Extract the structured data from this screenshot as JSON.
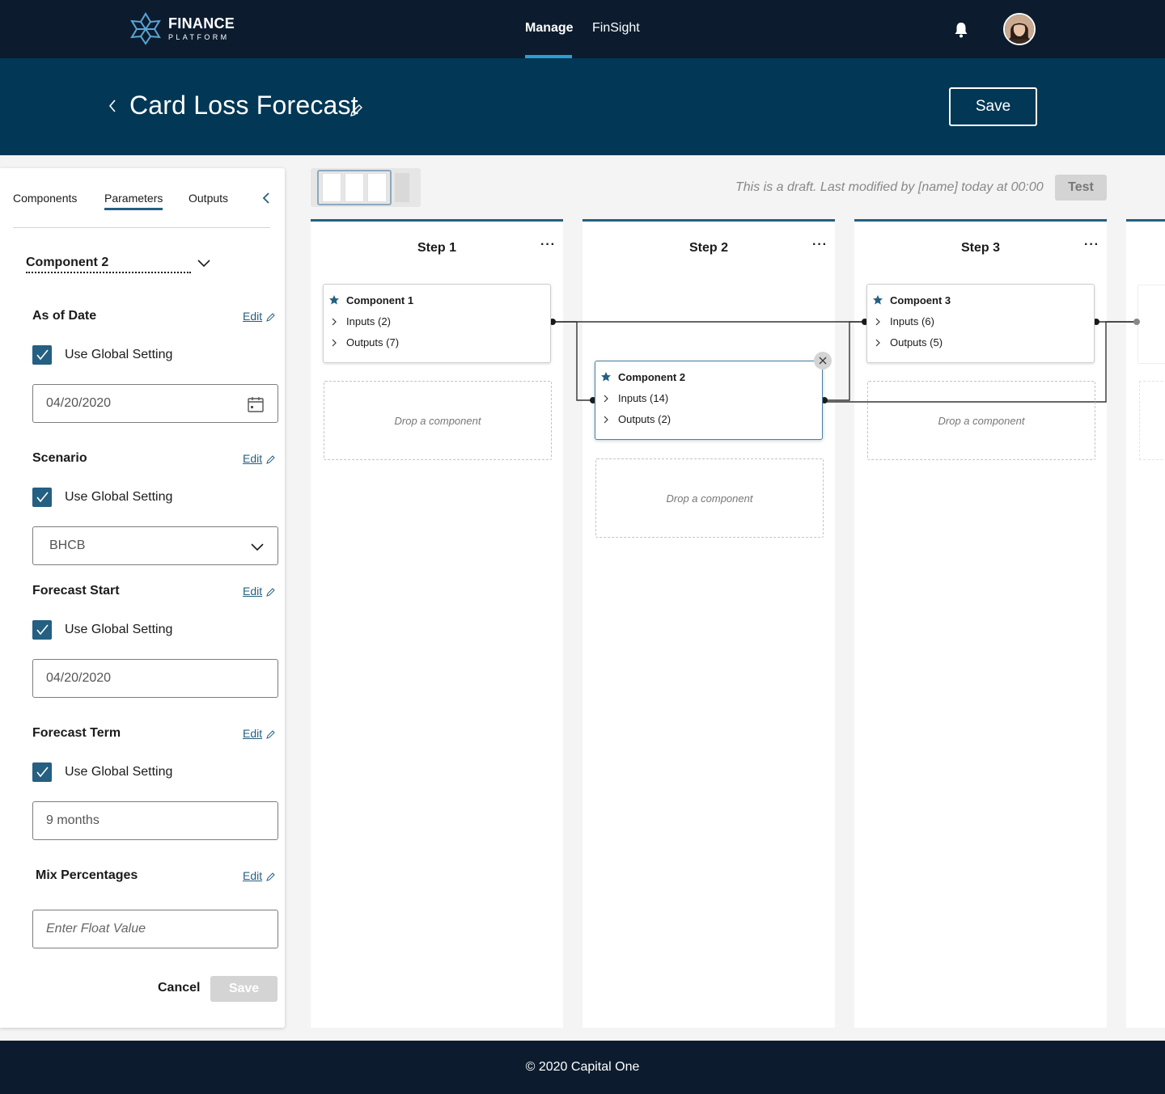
{
  "nav": {
    "logo_line1": "FINANCE",
    "logo_line2": "PLATFORM",
    "items": [
      "Manage",
      "FinSight"
    ],
    "active": "Manage"
  },
  "header": {
    "title": "Card Loss Forecast",
    "save_label": "Save"
  },
  "panel": {
    "tabs": [
      "Components",
      "Parameters",
      "Outputs"
    ],
    "active_tab": "Parameters",
    "component_select": "Component 2",
    "edit_label": "Edit",
    "checkbox_label": "Use Global Setting",
    "params": [
      {
        "label": "As of Date",
        "checked": true,
        "value": "04/20/2020"
      },
      {
        "label": "Scenario",
        "checked": true,
        "value": "BHCB"
      },
      {
        "label": "Forecast Start",
        "checked": true,
        "value": "04/20/2020"
      },
      {
        "label": "Forecast Term",
        "checked": true,
        "value": "9 months"
      },
      {
        "label": "Mix Percentages",
        "placeholder": "Enter Float Value"
      }
    ],
    "cancel_label": "Cancel",
    "save_label": "Save"
  },
  "canvas": {
    "draft_note": "This is a draft. Last modified by [name] today at 00:00",
    "test_label": "Test",
    "drop_label": "Drop a component",
    "steps": [
      {
        "title": "Step 1",
        "card": {
          "title": "Component 1",
          "inputs": "Inputs (2)",
          "outputs": "Outputs (7)"
        }
      },
      {
        "title": "Step 2",
        "card": {
          "title": "Component 2",
          "inputs": "Inputs (14)",
          "outputs": "Outputs (2)"
        }
      },
      {
        "title": "Step 3",
        "card": {
          "title": "Compoent 3",
          "inputs": "Inputs (6)",
          "outputs": "Outputs (5)"
        }
      }
    ]
  },
  "footer": {
    "copyright": "© 2020 Capital One"
  },
  "colors": {
    "nav_bg": "#0c1c2e",
    "header_bg": "#023755",
    "accent": "#255f82",
    "nav_indicator": "#2a9fd6"
  }
}
